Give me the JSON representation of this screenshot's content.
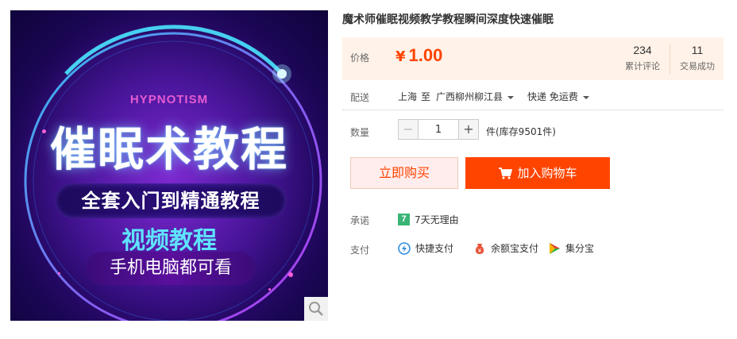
{
  "product": {
    "title": "魔术师催眠视频教学教程瞬间深度快速催眠",
    "image": {
      "en_title": "HYPNOTISM",
      "main_title": "催眠术教程",
      "subtitle": "全套入门到精通教程",
      "video_label": "视频教程",
      "devices": "手机电脑都可看"
    }
  },
  "price": {
    "label": "价格",
    "currency": "¥",
    "value": "1.00"
  },
  "stats": {
    "reviews_count": "234",
    "reviews_label": "累计评论",
    "sales_count": "11",
    "sales_label": "交易成功"
  },
  "shipping": {
    "label": "配送",
    "from": "上海",
    "to_word": "至",
    "destination": "广西柳州柳江县",
    "method": "快递 免运费"
  },
  "quantity": {
    "label": "数量",
    "value": "1",
    "minus": "−",
    "plus": "+",
    "stock": "件(库存9501件)"
  },
  "actions": {
    "buy_now": "立即购买",
    "add_to_cart": "加入购物车"
  },
  "promise": {
    "label": "承诺",
    "badge": "7",
    "text": "7天无理由"
  },
  "payment": {
    "label": "支付",
    "methods": [
      "快捷支付",
      "余额宝支付",
      "集分宝"
    ]
  },
  "colors": {
    "accent": "#ff4400",
    "price_bg": "#fff2e8",
    "promise_green": "#3ab576"
  },
  "icons": [
    "magnify-icon",
    "cart-icon",
    "quickpay-icon",
    "yuebao-icon",
    "jifenbao-icon",
    "caret-down-icon"
  ]
}
